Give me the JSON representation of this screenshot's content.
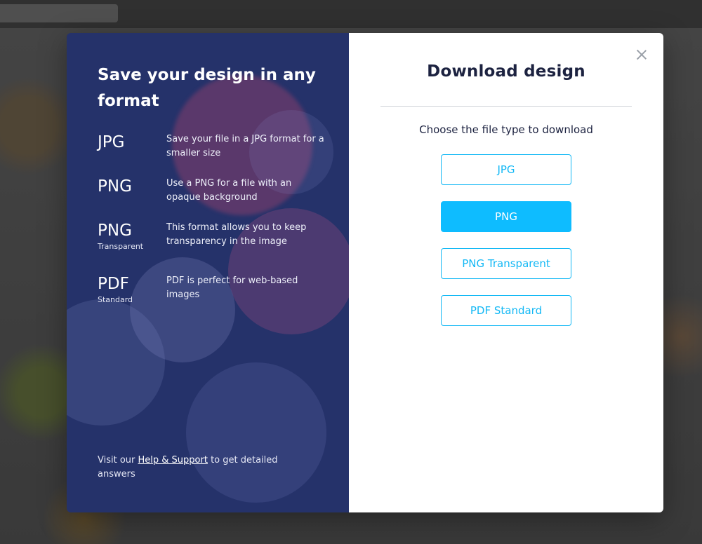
{
  "left_panel": {
    "title": "Save your design in any format",
    "formats": [
      {
        "name": "JPG",
        "sub": "",
        "desc": "Save your file in a JPG format for a smaller size"
      },
      {
        "name": "PNG",
        "sub": "",
        "desc": "Use a PNG for a file with an opaque background"
      },
      {
        "name": "PNG",
        "sub": "Transparent",
        "desc": "This format allows you to keep transparency in the image"
      },
      {
        "name": "PDF",
        "sub": "Standard",
        "desc": "PDF is perfect for web-based images"
      }
    ],
    "help": {
      "prefix": "Visit our ",
      "link": "Help & Support",
      "suffix": " to get detailed answers"
    }
  },
  "right_panel": {
    "title": "Download design",
    "subtitle": "Choose the file type to download",
    "buttons": [
      {
        "label": "JPG",
        "selected": false
      },
      {
        "label": "PNG",
        "selected": true
      },
      {
        "label": "PNG Transparent",
        "selected": false
      },
      {
        "label": "PDF Standard",
        "selected": false
      }
    ]
  },
  "icons": {
    "close": "close-icon"
  },
  "colors": {
    "accent": "#0ebcff",
    "panel": "#25326a",
    "title": "#1c2240"
  }
}
